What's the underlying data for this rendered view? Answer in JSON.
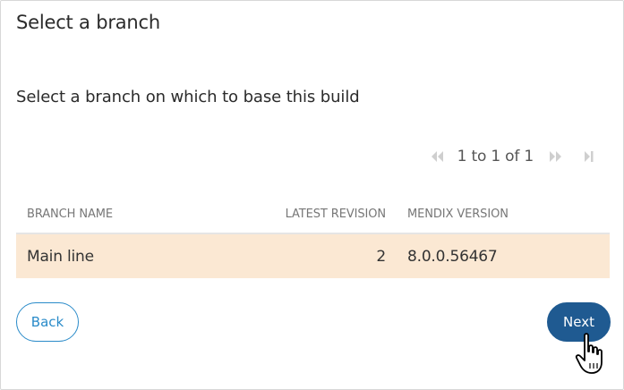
{
  "dialog": {
    "title": "Select a branch",
    "subtitle": "Select a branch on which to base this build"
  },
  "pager": {
    "text": "1 to 1 of 1",
    "icons": [
      "first-page-icon",
      "next-page-icon",
      "last-page-icon"
    ]
  },
  "table": {
    "columns": [
      "BRANCH NAME",
      "LATEST REVISION",
      "MENDIX VERSION"
    ],
    "rows": [
      {
        "branch": "Main line",
        "revision": "2",
        "version": "8.0.0.56467",
        "selected": true
      }
    ]
  },
  "buttons": {
    "back": "Back",
    "next": "Next"
  },
  "colors": {
    "selected_row": "#fbe8d3",
    "primary": "#1f5a91",
    "secondary_outline": "#2a8bc9"
  }
}
